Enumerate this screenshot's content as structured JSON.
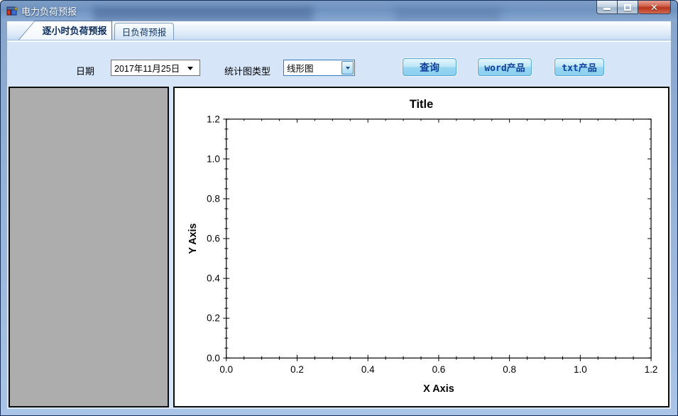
{
  "window": {
    "title": "电力负荷预报",
    "controls": [
      "minimize",
      "maximize",
      "close"
    ]
  },
  "tabs": [
    {
      "label": "逐小时负荷预报",
      "selected": true
    },
    {
      "label": "日负荷预报",
      "selected": false
    }
  ],
  "toolbar": {
    "date_label": "日期",
    "date_value": "2017年11月25日",
    "chart_type_label": "统计图类型",
    "chart_type_value": "线形图",
    "query_label": "查询",
    "word_label": "word产品",
    "txt_label": "txt产品"
  },
  "colors": {
    "titlebar_blue": "#7d9cc6",
    "toolbar_bg": "#d7e5f8",
    "button_face": "#a5d9f2",
    "button_border": "#56a7d4",
    "button_text": "#10409e",
    "left_panel_gray": "#adadad",
    "close_button_red": "#b8341c"
  },
  "chart_data": {
    "type": "line",
    "title": "Title",
    "xlabel": "X Axis",
    "ylabel": "Y Axis",
    "xlim": [
      0,
      1.2
    ],
    "ylim": [
      0,
      1.2
    ],
    "x_major_ticks": [
      0.0,
      0.2,
      0.4,
      0.6,
      0.8,
      1.0,
      1.2
    ],
    "y_major_ticks": [
      0.0,
      0.2,
      0.4,
      0.6,
      0.8,
      1.0,
      1.2
    ],
    "minor_tick_step": 0.05,
    "tick_label_decimals": 1,
    "grid": false,
    "legend_visible": false,
    "series": []
  }
}
